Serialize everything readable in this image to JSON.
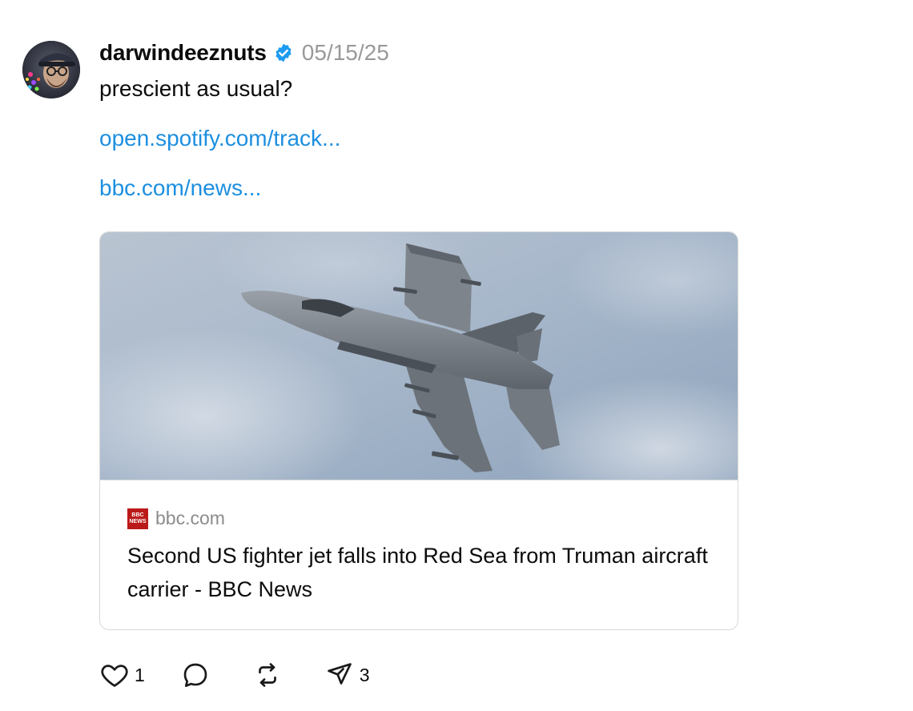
{
  "post": {
    "username": "darwindeeznuts",
    "verified_icon": "verified-badge-icon",
    "date": "05/15/25",
    "text": "prescient as usual?",
    "links": [
      {
        "text": "open.spotify.com/track..."
      },
      {
        "text": "bbc.com/news..."
      }
    ]
  },
  "card": {
    "source_logo_top": "BBC",
    "source_logo_bottom": "NEWS",
    "source_domain": "bbc.com",
    "title": "Second US fighter jet falls into Red Sea from Truman aircraft carrier - BBC News",
    "image_description_icon": "fighter-jet-image"
  },
  "actions": {
    "like_count": "1",
    "reply_count": "",
    "repost_count": "",
    "share_count": "3"
  },
  "colors": {
    "link": "#1d8fe0",
    "verified": "#1d9bf0",
    "date": "#999999",
    "bbc_red": "#bb1919"
  }
}
